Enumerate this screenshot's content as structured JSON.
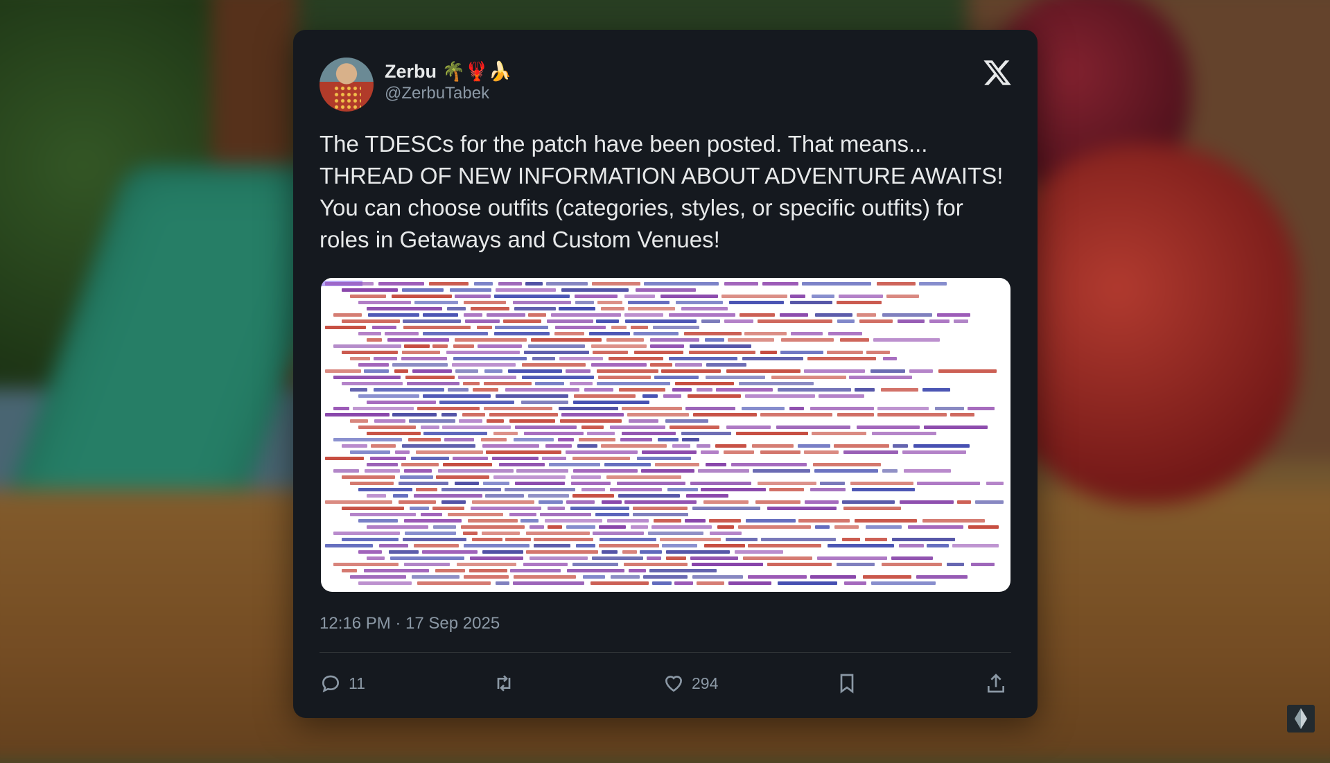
{
  "author": {
    "display_name": "Zerbu 🌴🦞🍌",
    "handle": "@ZerbuTabek"
  },
  "tweet": {
    "lines": [
      "The TDESCs for the patch have been posted. That means...",
      "THREAD OF NEW INFORMATION ABOUT ADVENTURE AWAITS!",
      "You can choose outfits (categories, styles, or specific outfits) for",
      "roles in Getaways and Custom Venues!"
    ],
    "timestamp": "12:16 PM · 17 Sep 2025"
  },
  "media": {
    "icon": "xml-code-screenshot"
  },
  "actions": {
    "reply_count": "11",
    "like_count": "294"
  },
  "icons": {
    "brand": "x-logo",
    "reply": "reply-icon",
    "repost": "repost-icon",
    "like": "heart-icon",
    "bookmark": "bookmark-icon",
    "share": "share-icon",
    "corner": "plumbob-icon"
  },
  "colors": {
    "card_bg": "#15191f",
    "text_primary": "#e7e9ea",
    "text_secondary": "#8b98a5"
  }
}
